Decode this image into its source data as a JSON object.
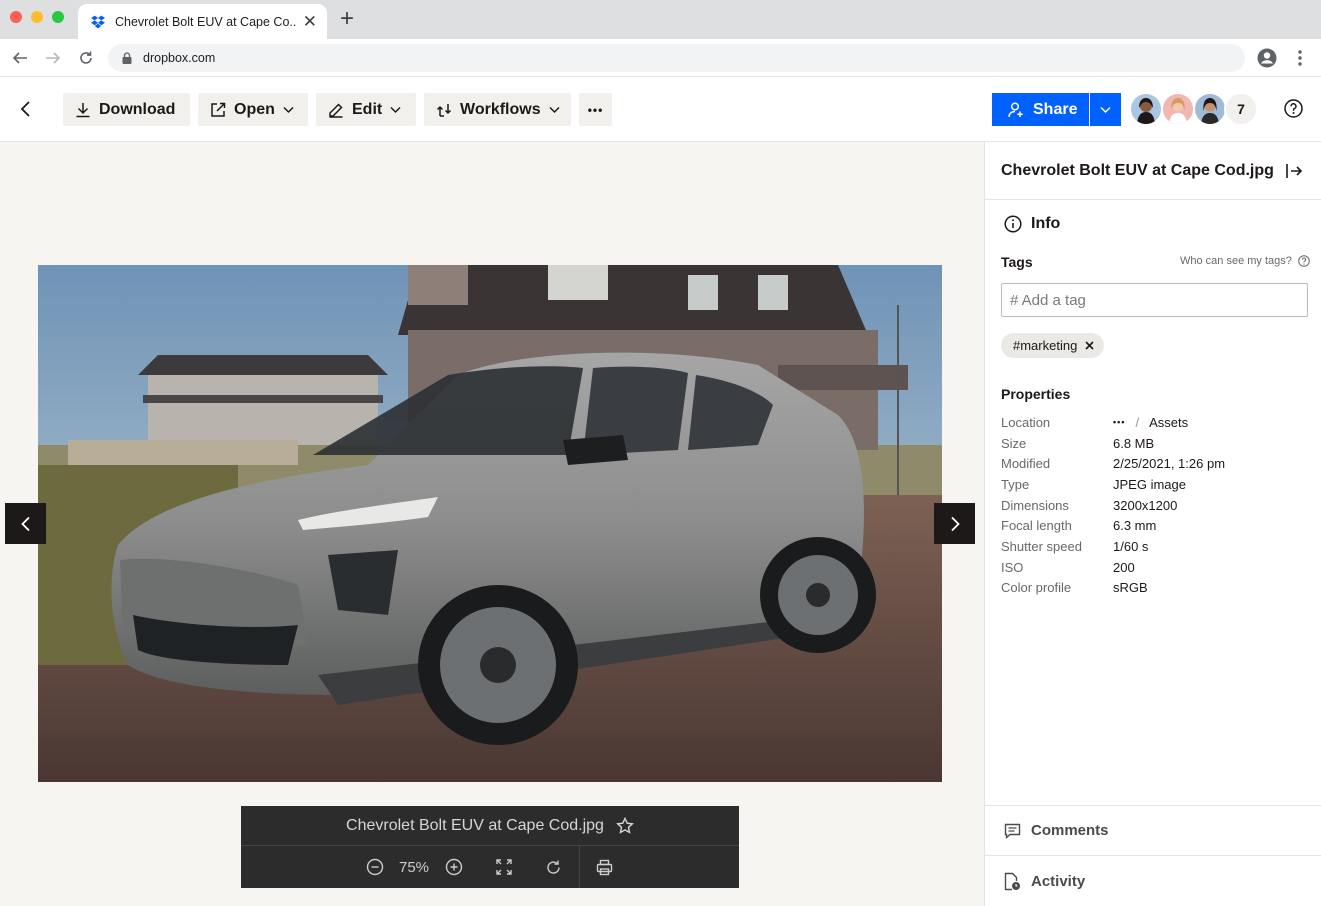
{
  "browser": {
    "tab_title": "Chevrolet Bolt EUV at Cape Co...",
    "tab_favicon": "dropbox-icon",
    "new_tab_label": "+",
    "url": "dropbox.com"
  },
  "toolbar": {
    "download_label": "Download",
    "open_label": "Open",
    "edit_label": "Edit",
    "workflows_label": "Workflows",
    "more_label": "•••",
    "share_label": "Share",
    "member_count": "7"
  },
  "viewer": {
    "file_name": "Chevrolet Bolt EUV at Cape Cod.jpg",
    "zoom_level": "75%",
    "image_subject": "silver Chevrolet Bolt EUV parked in front of beach houses"
  },
  "panel": {
    "title": "Chevrolet Bolt EUV at Cape Cod.jpg",
    "info_heading": "Info",
    "tags_heading": "Tags",
    "who_can_see": "Who can see my tags?",
    "tag_placeholder": "# Add a tag",
    "tags": [
      "#marketing"
    ],
    "properties_heading": "Properties",
    "location": {
      "label": "Location",
      "ellipsis": "•••",
      "separator": "/",
      "folder": "Assets"
    },
    "properties": [
      {
        "label": "Size",
        "value": "6.8 MB"
      },
      {
        "label": "Modified",
        "value": "2/25/2021, 1:26 pm"
      },
      {
        "label": "Type",
        "value": "JPEG image"
      },
      {
        "label": "Dimensions",
        "value": "3200x1200"
      },
      {
        "label": "Focal length",
        "value": "6.3 mm"
      },
      {
        "label": "Shutter speed",
        "value": "1/60 s"
      },
      {
        "label": "ISO",
        "value": "200"
      },
      {
        "label": "Color profile",
        "value": "sRGB"
      }
    ],
    "comments_label": "Comments",
    "activity_label": "Activity"
  },
  "colors": {
    "accent": "#0061fe",
    "button_bg": "#f2f0ed",
    "viewer_bg": "#f7f5f2",
    "caption_bg": "#2c2c2c"
  }
}
